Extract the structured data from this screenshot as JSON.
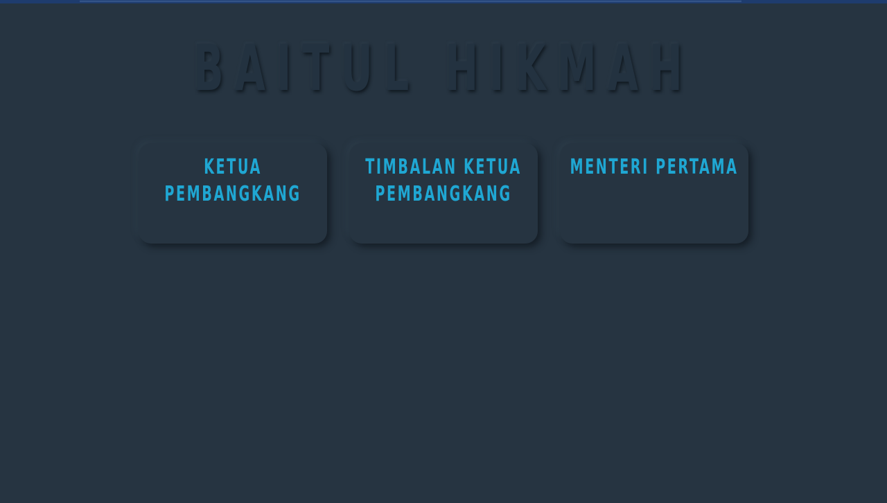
{
  "header": {
    "title": "BAITUL HIKMAH"
  },
  "cards": [
    {
      "label": "KETUA PEMBANGKANG"
    },
    {
      "label": "TIMBALAN KETUA PEMBANGKANG"
    },
    {
      "label": "MENTERI PERTAMA"
    }
  ],
  "colors": {
    "background": "#263441",
    "top_bar": "#1e3c6e",
    "card_text": "#1fa7d3",
    "title_text": "#233240"
  }
}
